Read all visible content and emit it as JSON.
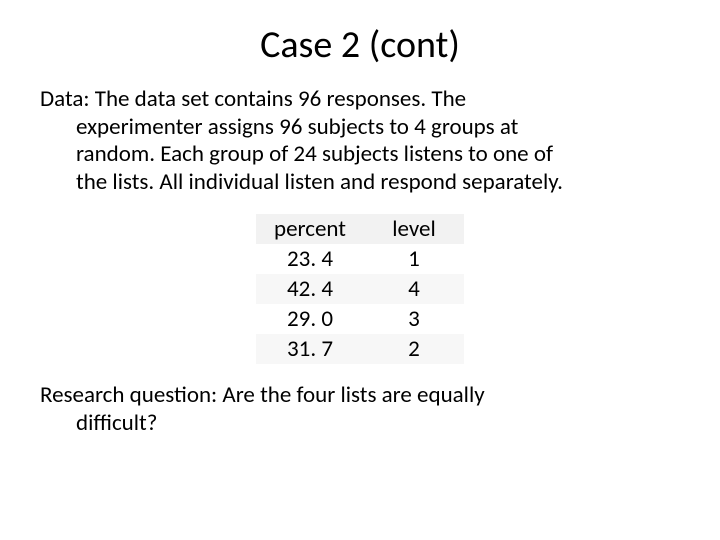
{
  "title": "Case 2 (cont)",
  "para1_line1": "Data: The data set contains 96 responses. The",
  "para1_line2": "experimenter assigns 96 subjects to 4 groups at",
  "para1_line3": "random. Each group of 24 subjects listens to one of",
  "para1_line4": "the lists. All individual listen and respond separately.",
  "table": {
    "headers": [
      "percent",
      "level"
    ],
    "rows": [
      [
        "23. 4",
        "1"
      ],
      [
        "42. 4",
        "4"
      ],
      [
        "29. 0",
        "3"
      ],
      [
        "31. 7",
        "2"
      ]
    ]
  },
  "para2_line1": "Research question: Are the four lists are equally",
  "para2_line2": "difficult?",
  "chart_data": {
    "type": "table",
    "columns": [
      "percent",
      "level"
    ],
    "rows": [
      {
        "percent": 23.4,
        "level": 1
      },
      {
        "percent": 42.4,
        "level": 4
      },
      {
        "percent": 29.0,
        "level": 3
      },
      {
        "percent": 31.7,
        "level": 2
      }
    ]
  }
}
